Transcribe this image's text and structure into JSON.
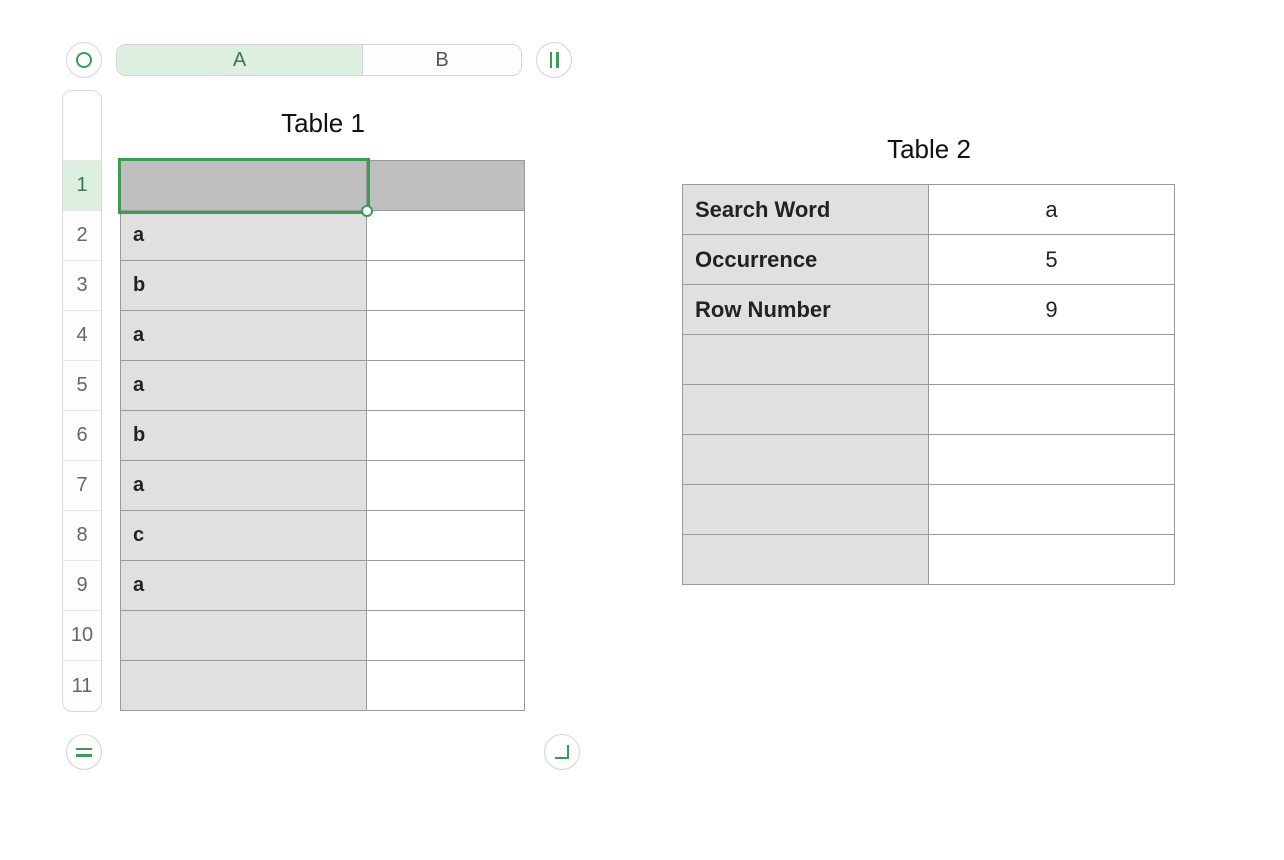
{
  "table1": {
    "title": "Table 1",
    "columnHeaders": [
      "A",
      "B"
    ],
    "activeColumnIndex": 0,
    "rowHeaders": [
      "1",
      "2",
      "3",
      "4",
      "5",
      "6",
      "7",
      "8",
      "9",
      "10",
      "11"
    ],
    "activeRowIndex": 0,
    "selectedCell": "A1",
    "data": {
      "A": [
        "",
        "a",
        "b",
        "a",
        "a",
        "b",
        "a",
        "c",
        "a",
        "",
        ""
      ],
      "B": [
        "",
        "",
        "",
        "",
        "",
        "",
        "",
        "",
        "",
        "",
        ""
      ]
    }
  },
  "table2": {
    "title": "Table 2",
    "rows": [
      {
        "label": "Search Word",
        "value": "a"
      },
      {
        "label": "Occurrence",
        "value": "5"
      },
      {
        "label": "Row Number",
        "value": "9"
      },
      {
        "label": "",
        "value": ""
      },
      {
        "label": "",
        "value": ""
      },
      {
        "label": "",
        "value": ""
      },
      {
        "label": "",
        "value": ""
      },
      {
        "label": "",
        "value": ""
      }
    ]
  },
  "icons": {
    "topLeft": "circle-icon",
    "topRight": "columns-icon",
    "bottomLeft": "rows-icon",
    "bottomRight": "resize-corner-icon"
  }
}
